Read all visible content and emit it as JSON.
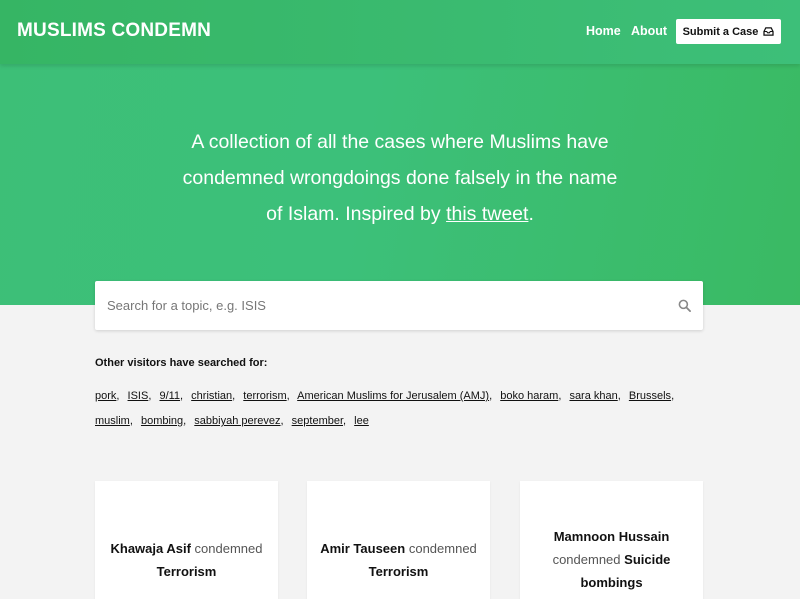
{
  "nav": {
    "brand": "MUSLIMS CONDEMN",
    "home": "Home",
    "about": "About",
    "submit": "Submit a Case",
    "submit_icon": "inbox-icon"
  },
  "hero": {
    "tagline_pre": "A collection of all the cases where Muslims have condemned wrongdoings done falsely in the name of Islam. Inspired by ",
    "tagline_link": "this tweet",
    "tagline_post": "."
  },
  "search": {
    "placeholder": "Search for a topic, e.g. ISIS",
    "value": "",
    "icon": "search-icon"
  },
  "others": {
    "label": "Other visitors have searched for:",
    "tags": [
      "pork",
      "ISIS",
      "9/11",
      "christian",
      "terrorism",
      "American Muslims for Jerusalem (AMJ)",
      "boko haram",
      "sara khan",
      "Brussels",
      "muslim",
      "bombing",
      "sabbiyah perevez",
      "september",
      "lee"
    ]
  },
  "cards": [
    {
      "name": "Khawaja Asif",
      "verb": "condemned",
      "topic": "Terrorism"
    },
    {
      "name": "Amir Tauseen",
      "verb": "condemned",
      "topic": "Terrorism"
    },
    {
      "name": "Mamnoon Hussain",
      "verb": "condemned",
      "topic": "Suicide bombings"
    }
  ],
  "colors": {
    "accent_green": "#3cc07a",
    "background": "#f3f3f3"
  }
}
